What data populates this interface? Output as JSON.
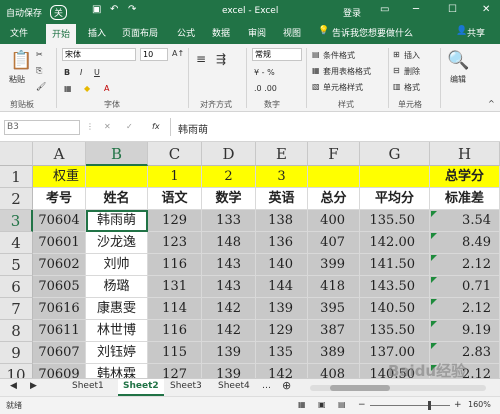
{
  "titlebar": {
    "autosave": "自动保存",
    "autosave_state": "关",
    "title": "excel - Excel",
    "login": "登录"
  },
  "tabs": [
    "文件",
    "开始",
    "插入",
    "页面布局",
    "公式",
    "数据",
    "审阅",
    "视图"
  ],
  "active_tab": "开始",
  "tell_me": "告诉我您想要做什么",
  "share": "共享",
  "ribbon": {
    "paste": "粘贴",
    "clipboard": "剪贴板",
    "font_name": "宋体",
    "font_size": "10",
    "font_group": "字体",
    "bold": "B",
    "italic": "I",
    "underline": "U",
    "align_group": "对齐方式",
    "number_format": "常规",
    "number_group": "数字",
    "cond_format": "条件格式",
    "table_format": "套用表格格式",
    "cell_style": "单元格样式",
    "styles_group": "样式",
    "insert": "插入",
    "delete": "删除",
    "format": "格式",
    "cells_group": "单元格",
    "edit": "编辑"
  },
  "formula_bar": {
    "name_box": "B3",
    "fx": "fx",
    "content": "韩雨萌"
  },
  "columns": [
    "A",
    "B",
    "C",
    "D",
    "E",
    "F",
    "G",
    "H"
  ],
  "rows": [
    {
      "num": "1",
      "cells": [
        "权重",
        "",
        "1",
        "2",
        "3",
        "",
        "",
        "总学分"
      ]
    },
    {
      "num": "2",
      "cells": [
        "考号",
        "姓名",
        "语文",
        "数学",
        "英语",
        "总分",
        "平均分",
        "标准差"
      ]
    },
    {
      "num": "3",
      "cells": [
        "70604",
        "韩雨萌",
        "129",
        "133",
        "138",
        "400",
        "135.50",
        "3.54"
      ]
    },
    {
      "num": "4",
      "cells": [
        "70601",
        "沙龙逸",
        "123",
        "148",
        "136",
        "407",
        "142.00",
        "8.49"
      ]
    },
    {
      "num": "5",
      "cells": [
        "70602",
        "刘帅",
        "116",
        "143",
        "140",
        "399",
        "141.50",
        "2.12"
      ]
    },
    {
      "num": "6",
      "cells": [
        "70605",
        "杨璐",
        "131",
        "143",
        "144",
        "418",
        "143.50",
        "0.71"
      ]
    },
    {
      "num": "7",
      "cells": [
        "70616",
        "康惠雯",
        "114",
        "142",
        "139",
        "395",
        "140.50",
        "2.12"
      ]
    },
    {
      "num": "8",
      "cells": [
        "70611",
        "林世博",
        "116",
        "142",
        "129",
        "387",
        "135.50",
        "9.19"
      ]
    },
    {
      "num": "9",
      "cells": [
        "70607",
        "刘钰婷",
        "115",
        "139",
        "135",
        "389",
        "137.00",
        "2.83"
      ]
    },
    {
      "num": "10",
      "cells": [
        "70609",
        "韩林霖",
        "127",
        "139",
        "142",
        "408",
        "140.50",
        "2.12"
      ]
    }
  ],
  "sheets": [
    "Sheet1",
    "Sheet2",
    "Sheet3",
    "Sheet4"
  ],
  "active_sheet": "Sheet2",
  "status": {
    "ready": "就绪",
    "zoom": "160%"
  },
  "watermark": "Baidu经验",
  "colors": {
    "brand": "#217346",
    "header_fill": "#ffff00",
    "selection": "#c8c8c8",
    "comment_marker": "#1e8b3c"
  }
}
